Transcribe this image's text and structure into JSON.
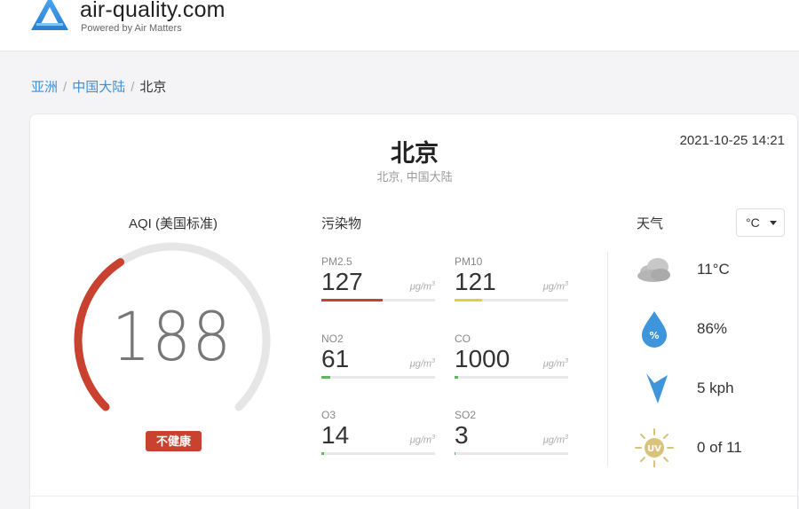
{
  "header": {
    "site_name": "air-quality.com",
    "site_sub": "Powered by Air Matters"
  },
  "breadcrumb": {
    "items": [
      "亚洲",
      "中国大陆",
      "北京"
    ],
    "separator": "/"
  },
  "city": {
    "title": "北京",
    "subtitle": "北京, 中国大陆",
    "timestamp": "2021-10-25 14:21"
  },
  "aqi": {
    "label": "AQI (美国标准)",
    "value": "188",
    "level": 0.376,
    "badge": "不健康",
    "color": "#c9412f"
  },
  "pollutants": {
    "title": "污染物",
    "items": [
      {
        "name": "PM2.5",
        "value": "127",
        "unit": "μg/m",
        "unit_sup": "3",
        "level": 0.54,
        "color": "#c9412f"
      },
      {
        "name": "PM10",
        "value": "121",
        "unit": "μg/m",
        "unit_sup": "3",
        "level": 0.24,
        "color": "#d9d43a"
      },
      {
        "name": "NO2",
        "value": "61",
        "unit": "μg/m",
        "unit_sup": "3",
        "level": 0.08,
        "color": "#5cb85c"
      },
      {
        "name": "CO",
        "value": "1000",
        "unit": "μg/m",
        "unit_sup": "3",
        "level": 0.03,
        "color": "#5cb85c"
      },
      {
        "name": "O3",
        "value": "14",
        "unit": "μg/m",
        "unit_sup": "3",
        "level": 0.02,
        "color": "#5cb85c"
      },
      {
        "name": "SO2",
        "value": "3",
        "unit": "μg/m",
        "unit_sup": "3",
        "level": 0.01,
        "color": "#5cb85c"
      }
    ]
  },
  "weather": {
    "title": "天气",
    "unit_selected": "°C",
    "items": [
      {
        "icon": "cloud-icon",
        "value": "11°C"
      },
      {
        "icon": "humidity-drop-icon",
        "value": "86%"
      },
      {
        "icon": "wind-direction-icon",
        "value": "5 kph"
      },
      {
        "icon": "uv-sun-icon",
        "value": "0 of 11"
      }
    ]
  }
}
